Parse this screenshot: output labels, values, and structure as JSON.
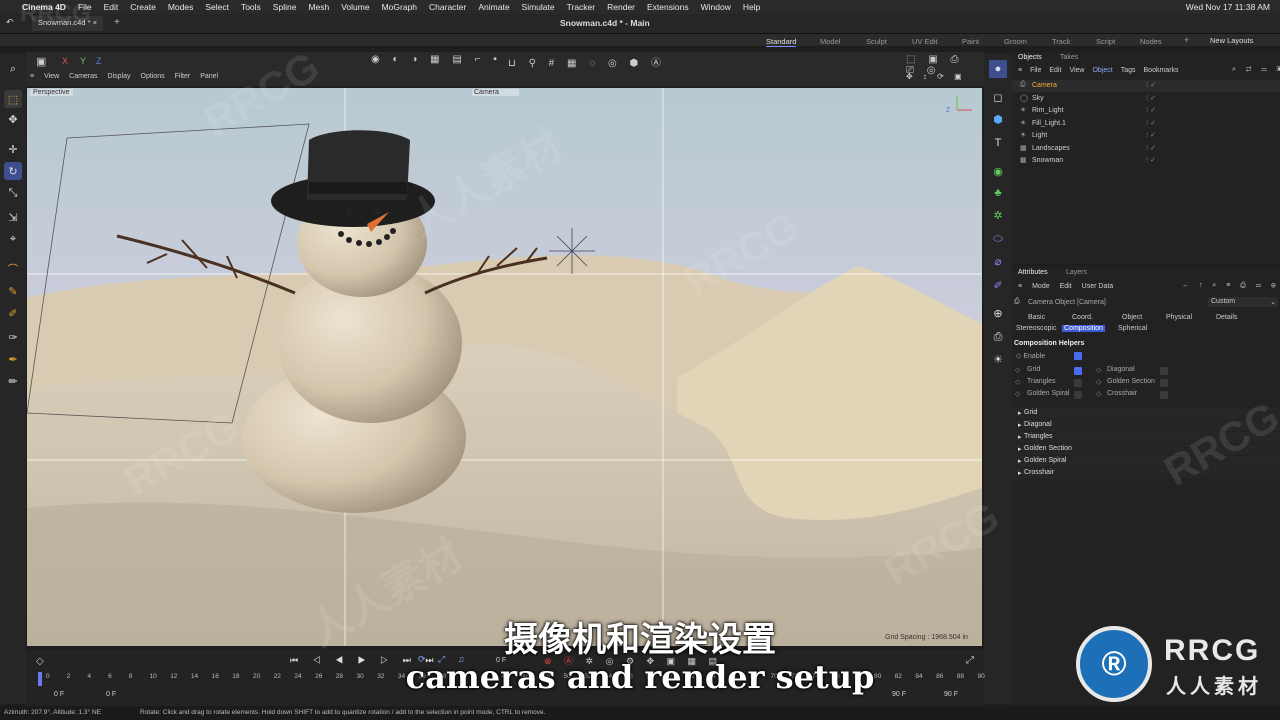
{
  "menubar": {
    "apple": "",
    "app": "Cinema 4D",
    "items": [
      "File",
      "Edit",
      "Create",
      "Modes",
      "Select",
      "Tools",
      "Spline",
      "Mesh",
      "Volume",
      "MoGraph",
      "Character",
      "Animate",
      "Simulate",
      "Tracker",
      "Render",
      "Extensions",
      "Window",
      "Help"
    ],
    "datetime": "Wed Nov 17  11:38 AM"
  },
  "window": {
    "title": "Snowman.c4d * - Main",
    "file_tab": "Snowman.c4d *"
  },
  "layouts": {
    "items": [
      "Standard",
      "Model",
      "Sculpt",
      "UV Edit",
      "Paint",
      "Groom",
      "Track",
      "Script",
      "Nodes"
    ],
    "active": "Standard",
    "new_label": "New Layouts"
  },
  "viewport": {
    "menu": [
      "View",
      "Cameras",
      "Display",
      "Options",
      "Filter",
      "Panel"
    ],
    "view_name": "Perspective",
    "camera_label": "Camera",
    "grid_spacing": "Grid Spacing : 1968.504 in",
    "axes": [
      "X",
      "Y",
      "Z"
    ]
  },
  "objects": {
    "tabs": [
      "Objects",
      "Takes"
    ],
    "menu": [
      "File",
      "Edit",
      "View",
      "Object",
      "Tags",
      "Bookmarks"
    ],
    "items": [
      "Camera",
      "Sky",
      "Rim_Light",
      "Fill_Light.1",
      "Light",
      "Landscapes",
      "Snowman"
    ]
  },
  "attributes": {
    "tabs": [
      "Attributes",
      "Layers"
    ],
    "menu": [
      "Mode",
      "Edit",
      "User Data"
    ],
    "object_label": "Camera Object [Camera]",
    "preset": "Custom",
    "subtabs1": [
      "Basic",
      "Coord.",
      "Object",
      "Physical",
      "Details"
    ],
    "subtabs2": [
      "Stereoscopic",
      "Composition",
      "Spherical"
    ],
    "section": "Composition Helpers",
    "enable": "Enable",
    "left_opts": [
      "Grid",
      "Triangles",
      "Golden Spiral"
    ],
    "right_opts": [
      "Diagonal",
      "Golden Section",
      "Crosshair"
    ],
    "groups": [
      "Grid",
      "Diagonal",
      "Triangles",
      "Golden Section",
      "Golden Spiral",
      "Crosshair"
    ]
  },
  "timeline": {
    "frame": "0 F",
    "start": "0 F",
    "start2": "0 F",
    "end": "90 F",
    "end2": "90 F",
    "ticks": [
      "0",
      "2",
      "4",
      "6",
      "8",
      "10",
      "12",
      "14",
      "16",
      "18",
      "20",
      "22",
      "24",
      "26",
      "28",
      "30",
      "32",
      "34",
      "36",
      "38",
      "40",
      "42",
      "44",
      "46",
      "48",
      "50",
      "52",
      "54",
      "56",
      "58",
      "60",
      "62",
      "64",
      "66",
      "68",
      "70",
      "72",
      "74",
      "76",
      "78",
      "80",
      "82",
      "84",
      "86",
      "88",
      "90"
    ]
  },
  "status": {
    "azimuth": "Azimuth: 207.9°, Altitude: 1.3°  NE",
    "hint": "Rotate: Click and drag to rotate elements. Hold down SHIFT to add to quantize rotation / add to the selection in point mode, CTRL to remove."
  },
  "subtitle": {
    "cn": "摄像机和渲染设置",
    "en": "cameras and render setup"
  },
  "watermark": {
    "text": "RRCG",
    "cn": "人人素材",
    "logo_main": "RRCG",
    "logo_sub": "人人素材"
  }
}
